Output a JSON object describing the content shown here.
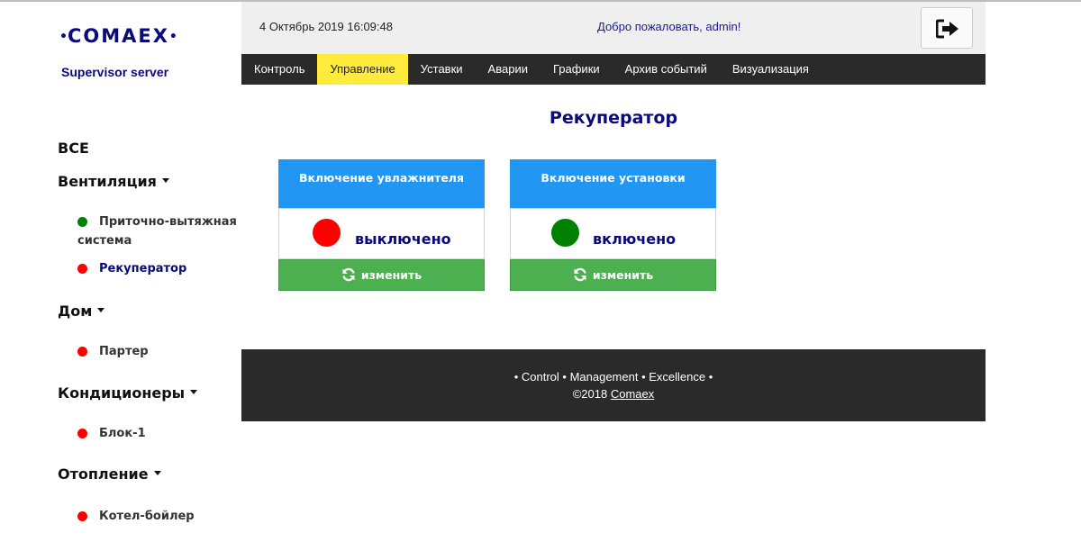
{
  "brand": {
    "name": "COMAEX",
    "left_dot": "•",
    "right_dot": "•",
    "subtitle": "Supervisor server"
  },
  "header": {
    "datetime": "4 Октябрь 2019 16:09:48",
    "welcome": "Добро пожаловать, admin!",
    "logout_icon": "sign-out-icon"
  },
  "nav": {
    "items": [
      {
        "label": "Контроль",
        "active": false
      },
      {
        "label": "Управление",
        "active": true
      },
      {
        "label": "Уставки",
        "active": false
      },
      {
        "label": "Аварии",
        "active": false
      },
      {
        "label": "Графики",
        "active": false
      },
      {
        "label": "Архив событий",
        "active": false
      },
      {
        "label": "Визуализация",
        "active": false
      }
    ],
    "active_color": "#ffeb3b"
  },
  "sidebar": {
    "all": "ВСЕ",
    "groups": [
      {
        "label": "Вентиляция",
        "items": [
          {
            "label": "Приточно-вытяжная система",
            "status": "green"
          },
          {
            "label": "Рекуператор",
            "status": "red",
            "active": true
          }
        ]
      },
      {
        "label": "Дом",
        "items": [
          {
            "label": "Партер",
            "status": "red"
          }
        ]
      },
      {
        "label": "Кондиционеры",
        "items": [
          {
            "label": "Блок-1",
            "status": "red"
          }
        ]
      },
      {
        "label": "Отопление",
        "items": [
          {
            "label": "Котел-бойлер",
            "status": "red"
          }
        ]
      }
    ]
  },
  "main": {
    "title": "Рекуператор",
    "cards": [
      {
        "title": "Включение увлажнителя",
        "state": "выключено",
        "state_color": "#ff0000",
        "button": "изменить"
      },
      {
        "title": "Включение установки",
        "state": "включено",
        "state_color": "#008000",
        "button": "изменить"
      }
    ],
    "card_header_color": "#2196f3",
    "button_color": "#4caf50",
    "button_icon": "refresh-icon"
  },
  "footer": {
    "tagline": "• Control • Management • Excellence •",
    "copyright": "©2018",
    "link": "Comaex"
  },
  "colors": {
    "status_green": "#008000",
    "status_red": "#ff0000",
    "brand_navy": "#0a0a7a",
    "dark_bar": "#2a2a2a"
  }
}
